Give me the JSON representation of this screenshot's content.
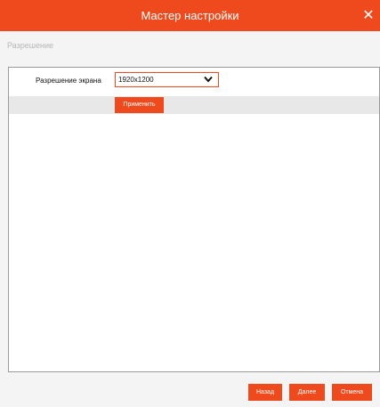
{
  "window": {
    "title": "Мастер настройки",
    "close_icon": "close-icon",
    "accent_color": "#ef4a1e"
  },
  "section": {
    "title": "Разрешение"
  },
  "resolution": {
    "label": "Разрешение экрана",
    "selected_value": "1920x1200",
    "dropdown_icon": "chevron-down-icon"
  },
  "actions": {
    "apply_label": "Применить"
  },
  "footer": {
    "back_label": "Назад",
    "next_label": "Далее",
    "cancel_label": "Отмена"
  }
}
